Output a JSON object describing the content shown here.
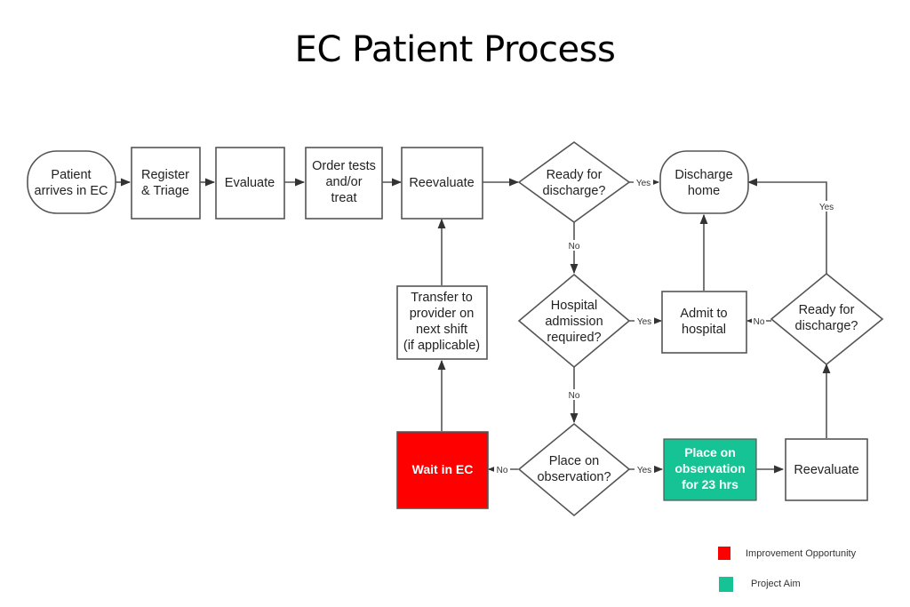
{
  "title": "EC Patient Process",
  "colors": {
    "improvement": "#ff0000",
    "project_aim": "#15c394",
    "stroke": "#555555"
  },
  "nodes": {
    "patient_arrives": [
      "Patient",
      "arrives in EC"
    ],
    "register_triage": [
      "Register",
      "& Triage"
    ],
    "evaluate": [
      "Evaluate"
    ],
    "order_tests": [
      "Order tests",
      "and/or",
      "treat"
    ],
    "reevaluate_1": [
      "Reevaluate"
    ],
    "ready_discharge_1": [
      "Ready for",
      "discharge?"
    ],
    "discharge_home": [
      "Discharge",
      "home"
    ],
    "transfer_provider": [
      "Transfer to",
      "provider on",
      "next shift",
      "(if applicable)"
    ],
    "hospital_admission": [
      "Hospital",
      "admission",
      "required?"
    ],
    "admit_hospital": [
      "Admit to",
      "hospital"
    ],
    "ready_discharge_2": [
      "Ready for",
      "discharge?"
    ],
    "wait_ec": [
      "Wait in EC"
    ],
    "place_observation": [
      "Place on",
      "observation?"
    ],
    "observation_23": [
      "Place on",
      "observation",
      "for 23 hrs"
    ],
    "reevaluate_2": [
      "Reevaluate"
    ]
  },
  "edge_labels": {
    "yes": "Yes",
    "no": "No"
  },
  "legend": [
    {
      "label": "Improvement Opportunity",
      "color": "#ff0000"
    },
    {
      "label": "Project Aim",
      "color": "#15c394"
    }
  ]
}
